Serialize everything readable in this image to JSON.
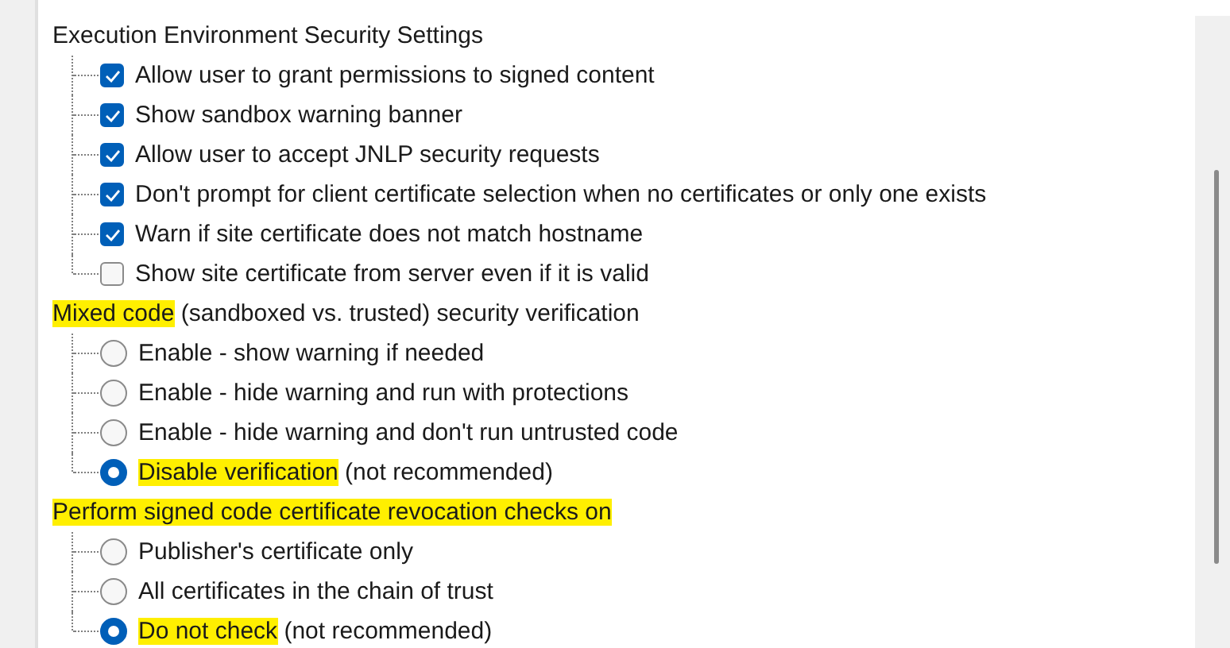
{
  "groups": [
    {
      "heading": [
        {
          "text": "Execution Environment Security Settings",
          "highlighted": false
        }
      ],
      "items": [
        {
          "kind": "checkbox",
          "checked": true,
          "label": [
            {
              "text": "Allow user to grant permissions to signed content",
              "highlighted": false
            }
          ]
        },
        {
          "kind": "checkbox",
          "checked": true,
          "label": [
            {
              "text": "Show sandbox warning banner",
              "highlighted": false
            }
          ]
        },
        {
          "kind": "checkbox",
          "checked": true,
          "label": [
            {
              "text": "Allow user to accept JNLP security requests",
              "highlighted": false
            }
          ]
        },
        {
          "kind": "checkbox",
          "checked": true,
          "label": [
            {
              "text": "Don't prompt for client certificate selection when no certificates or only one exists",
              "highlighted": false
            }
          ]
        },
        {
          "kind": "checkbox",
          "checked": true,
          "label": [
            {
              "text": "Warn if site certificate does not match hostname",
              "highlighted": false
            }
          ]
        },
        {
          "kind": "checkbox",
          "checked": false,
          "label": [
            {
              "text": "Show site certificate from server even if it is valid",
              "highlighted": false
            }
          ]
        }
      ]
    },
    {
      "heading": [
        {
          "text": "Mixed code",
          "highlighted": true
        },
        {
          "text": " (sandboxed vs. trusted) security verification",
          "highlighted": false
        }
      ],
      "items": [
        {
          "kind": "radio",
          "selected": false,
          "label": [
            {
              "text": "Enable - show warning if needed",
              "highlighted": false
            }
          ]
        },
        {
          "kind": "radio",
          "selected": false,
          "label": [
            {
              "text": "Enable - hide warning and run with protections",
              "highlighted": false
            }
          ]
        },
        {
          "kind": "radio",
          "selected": false,
          "label": [
            {
              "text": "Enable - hide warning and don't run untrusted code",
              "highlighted": false
            }
          ]
        },
        {
          "kind": "radio",
          "selected": true,
          "label": [
            {
              "text": "Disable verification",
              "highlighted": true
            },
            {
              "text": " (not recommended)",
              "highlighted": false
            }
          ]
        }
      ]
    },
    {
      "heading": [
        {
          "text": "Perform signed code certificate revocation checks on",
          "highlighted": true
        }
      ],
      "items": [
        {
          "kind": "radio",
          "selected": false,
          "label": [
            {
              "text": "Publisher's certificate only",
              "highlighted": false
            }
          ]
        },
        {
          "kind": "radio",
          "selected": false,
          "label": [
            {
              "text": "All certificates in the chain of trust",
              "highlighted": false
            }
          ]
        },
        {
          "kind": "radio",
          "selected": true,
          "label": [
            {
              "text": "Do not check",
              "highlighted": true
            },
            {
              "text": " (not recommended)",
              "highlighted": false
            }
          ]
        }
      ]
    }
  ]
}
